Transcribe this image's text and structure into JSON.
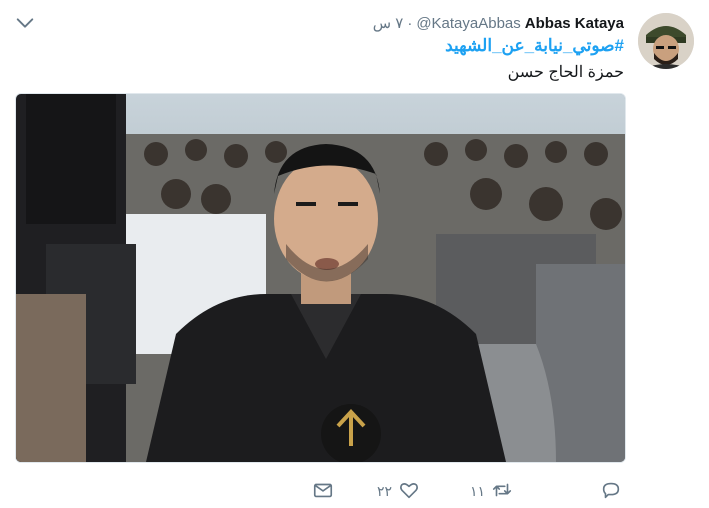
{
  "tweet": {
    "author_name": "Abbas Kataya",
    "author_handle": "@KatayaAbbas",
    "separator": "·",
    "time": "٧ س",
    "hashtag": "#صوتي_نيابة_عن_الشهيد",
    "text": "حمزة الحاج حسن",
    "media_alt": "",
    "media_logo_text": ""
  },
  "actions": {
    "reply_count": "",
    "retweet_count": "١١",
    "like_count": "٢٢",
    "message_count": ""
  },
  "colors": {
    "link": "#1da1f2",
    "muted": "#657786",
    "text": "#14171a"
  },
  "icons": {
    "caret": "chevron-down-icon",
    "reply": "reply-icon",
    "retweet": "retweet-icon",
    "like": "heart-icon",
    "message": "envelope-icon"
  }
}
